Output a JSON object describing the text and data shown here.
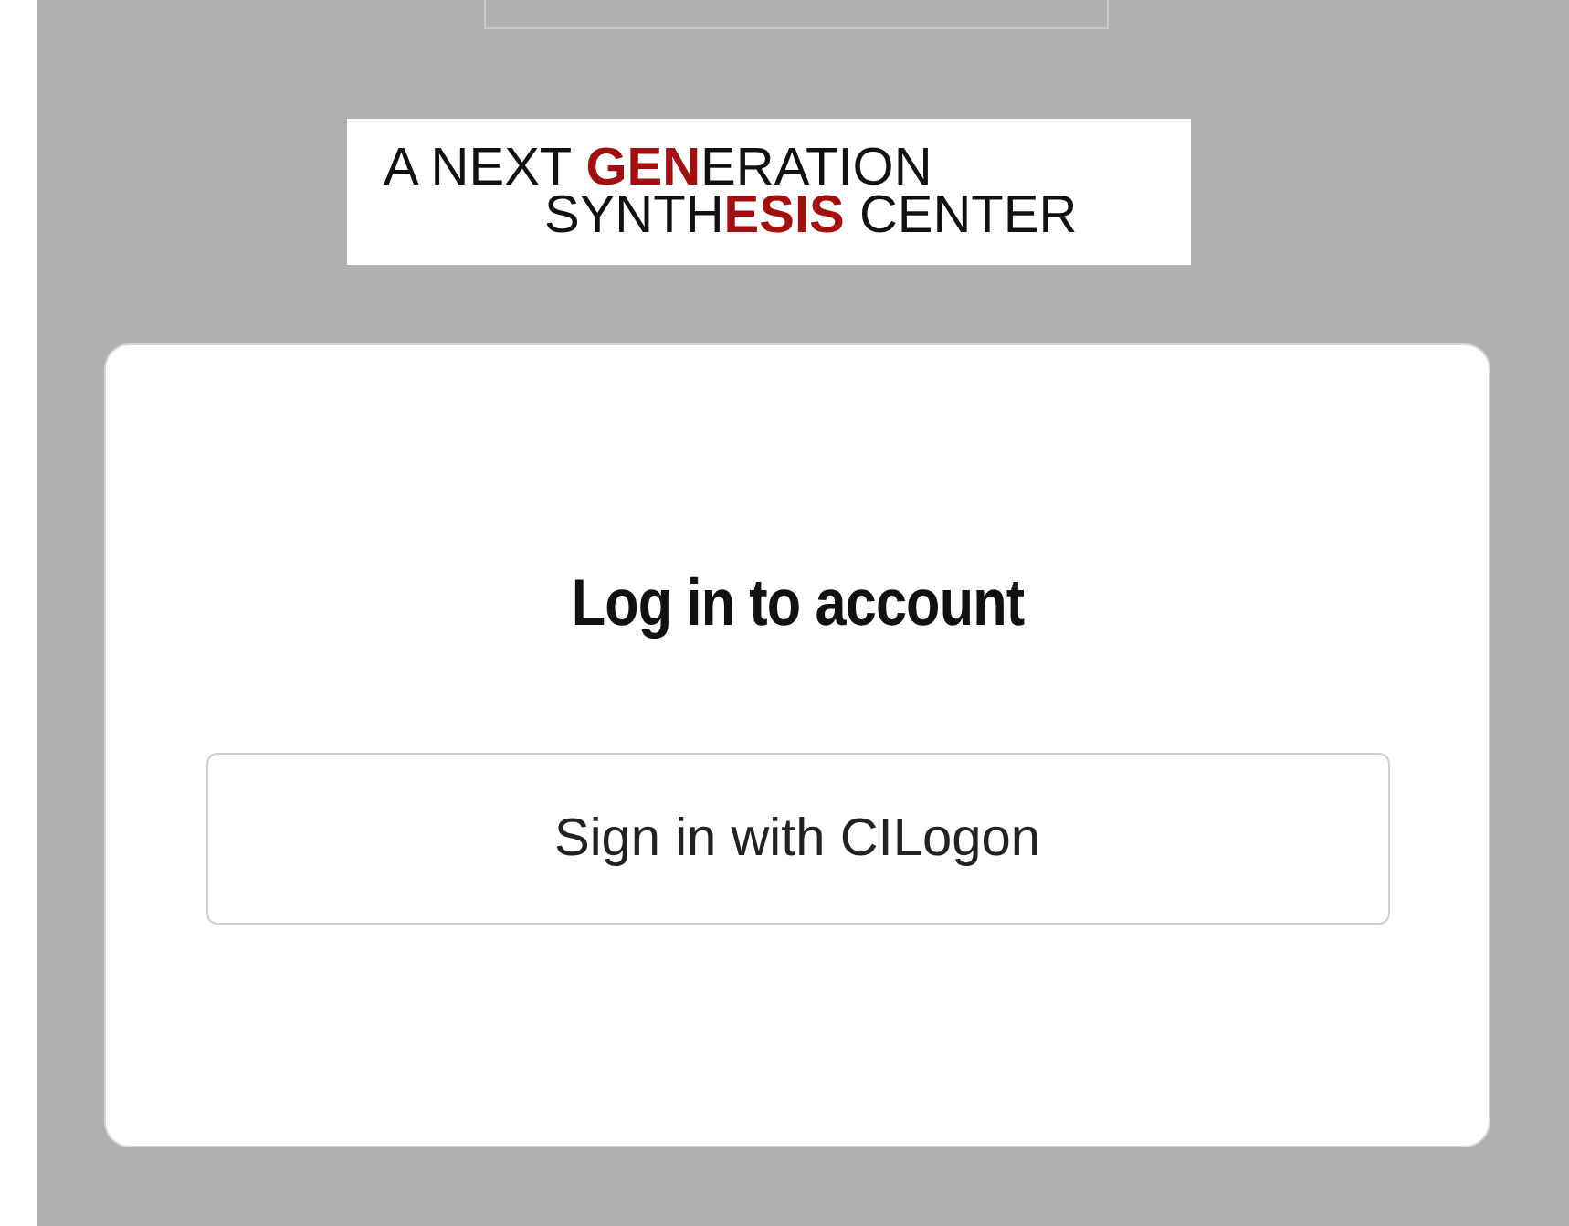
{
  "logo": {
    "lines": [
      "A NEXT **GEN**ERATION",
      "SYNTH**ESIS** CENTER"
    ]
  },
  "login": {
    "title": "Log in to account",
    "button": "Sign in with CILogon"
  }
}
